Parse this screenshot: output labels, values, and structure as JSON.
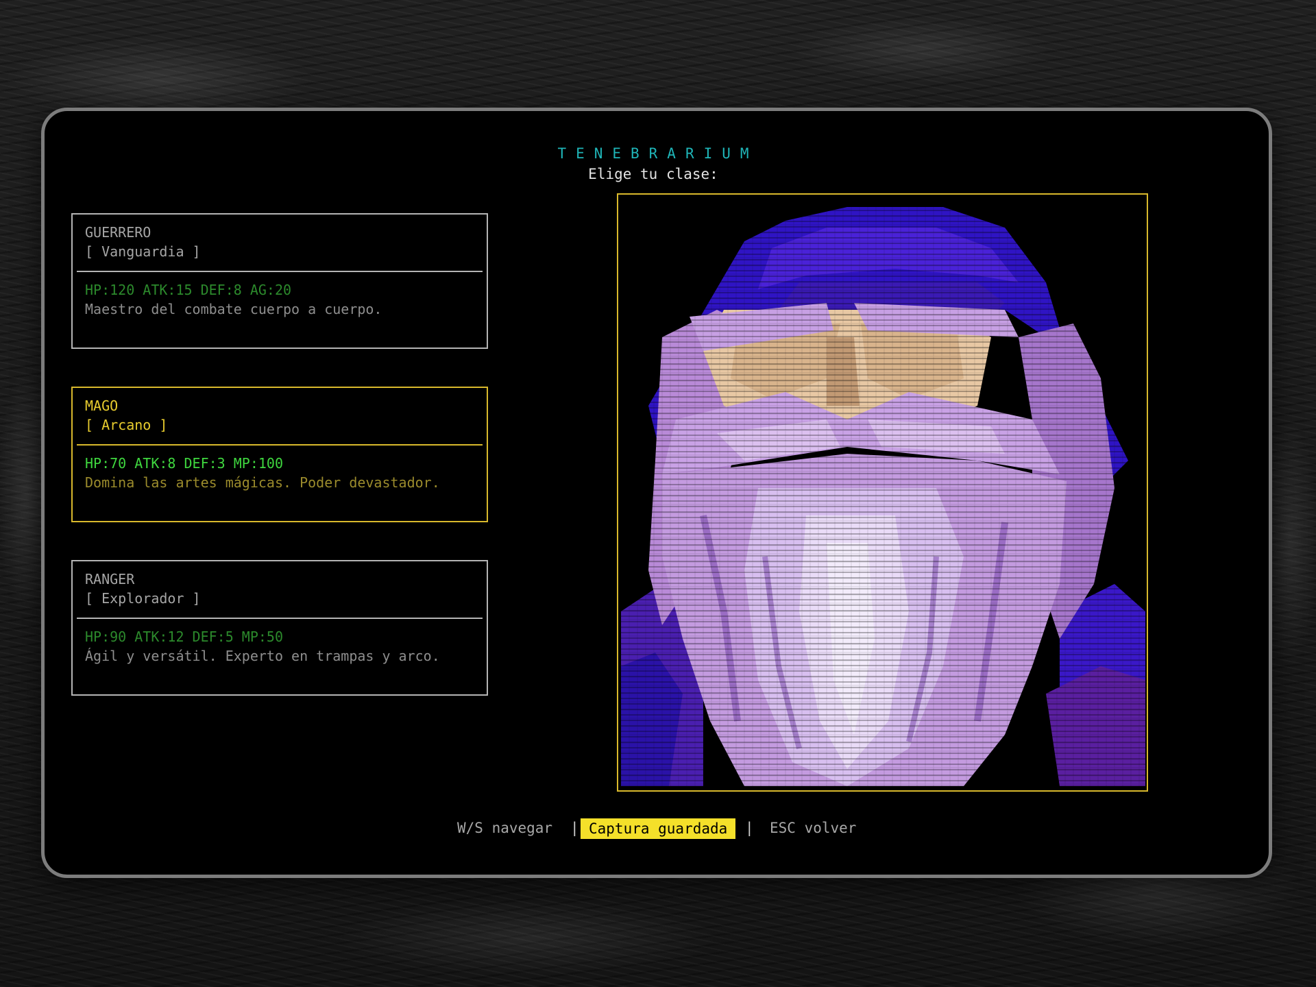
{
  "game": {
    "title": "TENEBRARIUM",
    "prompt": "Elige tu clase:"
  },
  "classes": [
    {
      "name": "GUERRERO",
      "role": "[ Vanguardia ]",
      "stats": "HP:120 ATK:15 DEF:8 AG:20",
      "description": "Maestro del combate cuerpo a cuerpo.",
      "selected": false
    },
    {
      "name": "MAGO",
      "role": "[ Arcano ]",
      "stats": "HP:70 ATK:8 DEF:3 MP:100",
      "description": "Domina las artes mágicas. Poder devastador.",
      "selected": true
    },
    {
      "name": "RANGER",
      "role": "[ Explorador ]",
      "stats": "HP:90 ATK:12 DEF:5 MP:50",
      "description": "Ágil y versátil. Experto en trampas y arco.",
      "selected": false
    }
  ],
  "footer": {
    "navigate": "W/S navegar",
    "separator": "|",
    "toast": "Captura guardada",
    "back": "ESC volver"
  },
  "colors": {
    "accent_cyan": "#1fb5b8",
    "selected_yellow": "#e8cc2e",
    "stats_green": "#3fd73f",
    "toast_bg": "#f4e02a"
  },
  "portrait": {
    "subject": "wizard-portrait",
    "style": "pixel-art"
  }
}
